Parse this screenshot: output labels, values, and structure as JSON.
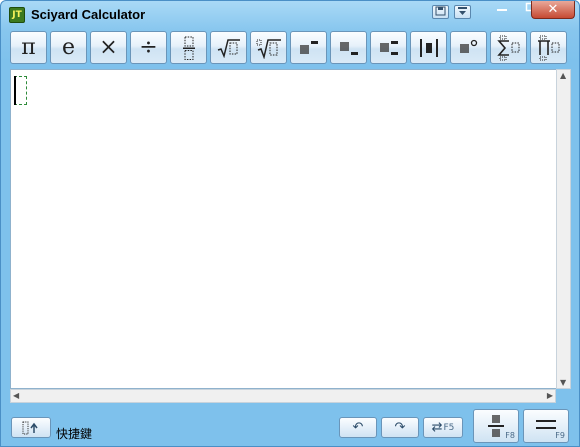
{
  "window": {
    "title": "Sciyard Calculator",
    "app_icon_text": "JT",
    "controls": {
      "minimize": "—",
      "maximize": "□",
      "close": "✕"
    },
    "extra_controls": {
      "save_icon": "💾",
      "dropdown_icon": "▾"
    }
  },
  "toolbar": {
    "buttons": [
      {
        "name": "pi-button",
        "glyph": "π"
      },
      {
        "name": "e-button",
        "glyph": "e"
      },
      {
        "name": "multiply-button",
        "glyph": "×"
      },
      {
        "name": "divide-button",
        "glyph": "÷"
      },
      {
        "name": "fraction-button",
        "glyph": "⬚⁄⬚"
      },
      {
        "name": "sqrt-button",
        "glyph": "√⬚"
      },
      {
        "name": "nth-root-button",
        "glyph": "ⁿ√⬚"
      },
      {
        "name": "power-button",
        "glyph": "▩⁻"
      },
      {
        "name": "subscript-button",
        "glyph": "▩₋"
      },
      {
        "name": "sub-sup-button",
        "glyph": "▩⁼"
      },
      {
        "name": "abs-button",
        "glyph": "|⬚|"
      },
      {
        "name": "degree-button",
        "glyph": "▩°"
      },
      {
        "name": "sum-button",
        "glyph": "Σ⬚"
      },
      {
        "name": "product-button",
        "glyph": "∏⬚"
      }
    ]
  },
  "bottom": {
    "shortcut_label": "快捷鍵",
    "undo_glyph": "↶",
    "redo_glyph": "↷",
    "swap_glyph": "⇄",
    "f5": "F5",
    "f8": "F8",
    "f9": "F9",
    "fraction_glyph": "÷",
    "equals_glyph": "="
  }
}
